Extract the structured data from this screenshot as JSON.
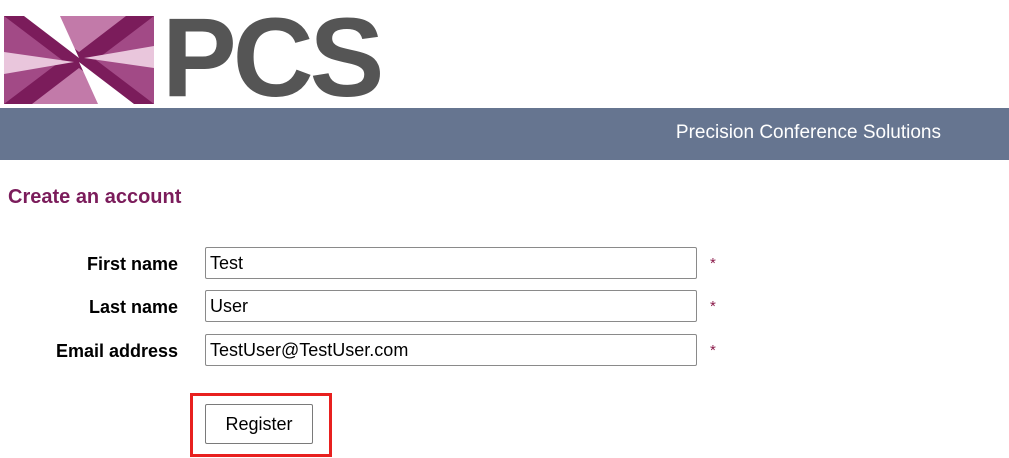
{
  "header": {
    "logo_text": "PCS",
    "tagline": "Precision Conference Solutions",
    "brand_color": "#7b1c5b",
    "banner_color": "#667590"
  },
  "page": {
    "title": "Create an account"
  },
  "form": {
    "fields": [
      {
        "label": "First name",
        "value": "Test",
        "required_mark": "*"
      },
      {
        "label": "Last name",
        "value": "User",
        "required_mark": "*"
      },
      {
        "label": "Email address",
        "value": "TestUser@TestUser.com",
        "required_mark": "*"
      }
    ],
    "register_label": "Register",
    "highlight_color": "#e8201f"
  }
}
